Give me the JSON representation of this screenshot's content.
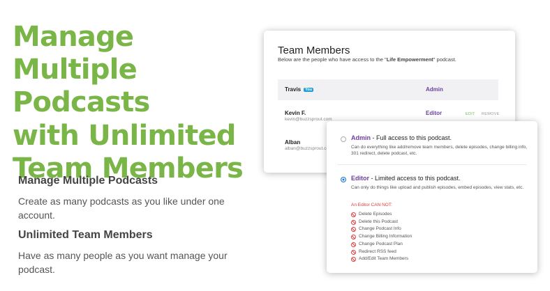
{
  "colors": {
    "headline": "#7ab547",
    "role_link": "#6b3fa0",
    "edit_link": "#7ab547",
    "warning": "#e03a3a",
    "selected_radio": "#1e78d6",
    "badge": "#1f9fd6"
  },
  "headline": {
    "lines": [
      "Manage Multiple",
      "Podcasts",
      "with Unlimited",
      "Team Members"
    ]
  },
  "features": [
    {
      "heading": "Manage Multiple Podcasts",
      "body": "Create as many podcasts as you like under one account."
    },
    {
      "heading": "Unlimited Team Members",
      "body": "Have as many people as you want manage your podcast."
    }
  ],
  "team_card": {
    "title": "Team Members",
    "subtitle_prefix": "Below are the people who have access to the \"",
    "podcast_name": "Life Empowerment",
    "subtitle_suffix": "\" podcast.",
    "members": [
      {
        "name": "Travis",
        "badge": "You",
        "email": "",
        "role": "Admin"
      },
      {
        "name": "Kevin F.",
        "email": "kevin@buzzsprout.com",
        "role": "Editor",
        "edit_label": "EDIT",
        "remove_label": "REMOVE"
      },
      {
        "name": "Alban",
        "email": "alban@buzzsprout.com"
      }
    ]
  },
  "roles_card": {
    "admin": {
      "name": "Admin",
      "summary": " - Full access to this podcast.",
      "description": "Can do everything like add/remove team members, delete episodes, change billing info, 301 redirect, delete podcast, etc.",
      "selected": false
    },
    "editor": {
      "name": "Editor",
      "summary": " - Limited access to this podcast.",
      "description": "Can only do things like upload and publish episodes, embed episodes, view stats, etc.",
      "selected": true
    },
    "cannot_title": "An Editor CAN NOT:",
    "cannot_items": [
      "Delete Episodes",
      "Delete this Podcast",
      "Change Podcast Info",
      "Change Billing Information",
      "Change Podcast Plan",
      "Redirect RSS feed",
      "Add/Edit Team Members"
    ]
  }
}
